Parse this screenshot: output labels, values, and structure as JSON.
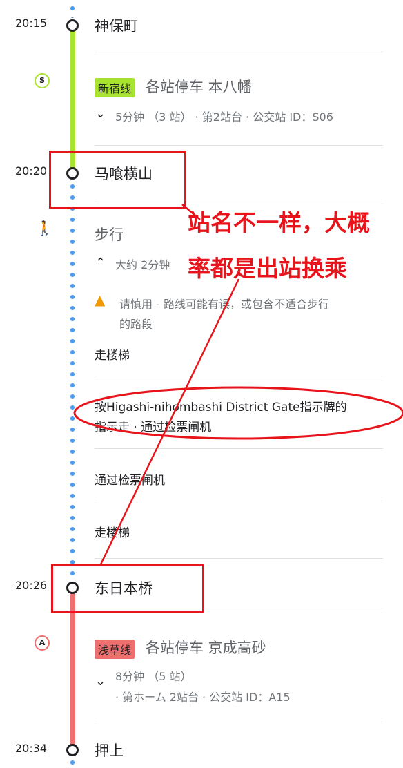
{
  "stops": [
    {
      "time": "20:15",
      "name": "神保町"
    },
    {
      "time": "20:20",
      "name": "马喰横山"
    },
    {
      "time": "20:26",
      "name": "东日本桥"
    },
    {
      "time": "20:34",
      "name": "押上"
    }
  ],
  "leg1": {
    "line_icon": "S",
    "line_name": "新宿线",
    "direction": "各站停车 本八幡",
    "details": "5分钟 （3 站） · 第2站台 · 公交站 ID：S06",
    "line_color": "#a8e32f"
  },
  "walk": {
    "title": "步行",
    "duration": "大约 2分钟",
    "warning": "请慎用 - 路线可能有误，或包含不适合步行",
    "warning2": "的路段",
    "steps": [
      "走楼梯",
      "按Higashi-nihombashi District Gate指示牌的",
      "指示走 · 通过检票闸机",
      "通过检票闸机",
      "走楼梯"
    ]
  },
  "leg2": {
    "line_icon": "A",
    "line_name": "浅草线",
    "direction": "各站停车 京成高砂",
    "details1": "8分钟 （5 站）",
    "details2": "· 第ホーム 2站台 · 公交站 ID：A15",
    "line_color": "#ee6f6f"
  },
  "annotation": {
    "line1": "站名不一样，大概",
    "line2": "率都是出站换乘"
  }
}
